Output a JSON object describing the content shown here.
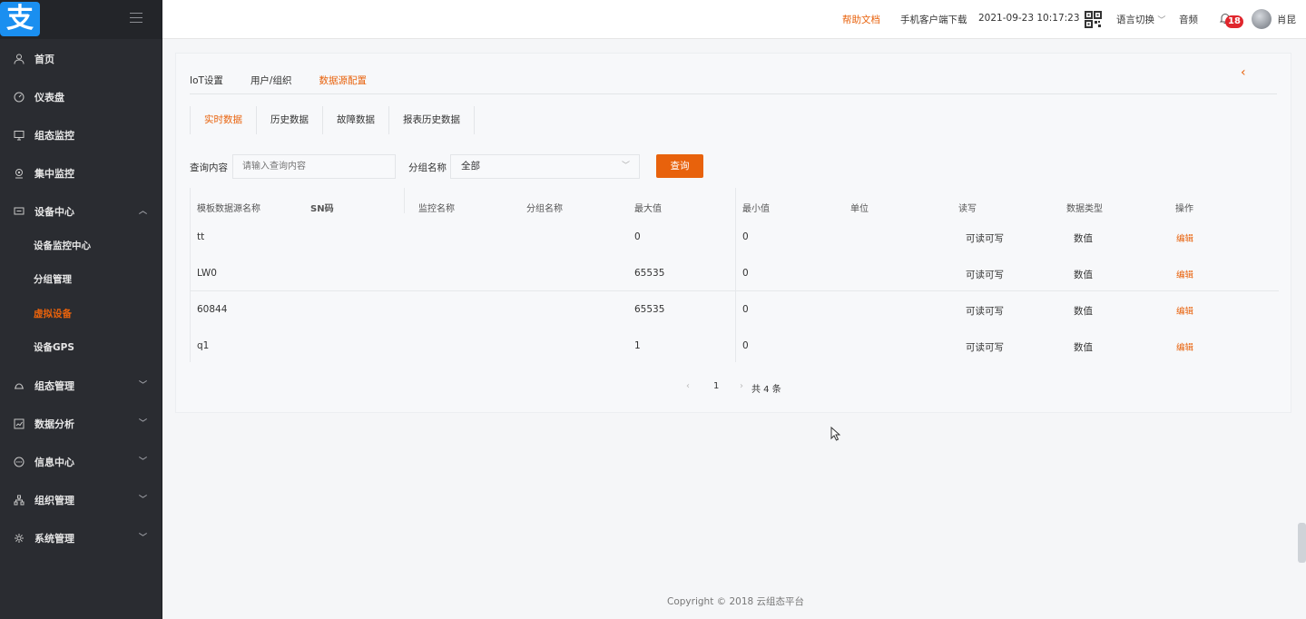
{
  "logo": {
    "glyph": "支"
  },
  "sidebar": {
    "items": [
      {
        "label": "首页",
        "icon": "user-icon"
      },
      {
        "label": "仪表盘",
        "icon": "dashboard-icon"
      },
      {
        "label": "组态监控",
        "icon": "monitor-icon"
      },
      {
        "label": "集中监控",
        "icon": "location-icon"
      },
      {
        "label": "设备中心",
        "icon": "device-icon",
        "expanded": true
      },
      {
        "label": "组态管理",
        "icon": "config-icon"
      },
      {
        "label": "数据分析",
        "icon": "chart-icon"
      },
      {
        "label": "信息中心",
        "icon": "message-icon"
      },
      {
        "label": "组织管理",
        "icon": "org-icon"
      },
      {
        "label": "系统管理",
        "icon": "settings-icon"
      }
    ],
    "sub_items": [
      {
        "label": "设备监控中心"
      },
      {
        "label": "分组管理"
      },
      {
        "label": "虚拟设备",
        "active": true
      },
      {
        "label": "设备GPS"
      }
    ]
  },
  "header": {
    "help": "帮助文档",
    "download": "手机客户端下载",
    "datetime": "2021-09-23 10:17:23",
    "language": "语言切换",
    "audio": "音频",
    "badge_count": "18",
    "username": "肖昆"
  },
  "tabs": [
    "IoT设置",
    "用户/组织",
    "数据源配置"
  ],
  "sub_tabs": [
    "实时数据",
    "历史数据",
    "故障数据",
    "报表历史数据"
  ],
  "search": {
    "query_label": "查询内容",
    "query_placeholder": "请输入查询内容",
    "group_label": "分组名称",
    "group_value": "全部",
    "button": "查询"
  },
  "table": {
    "headers": [
      "模板数据源名称",
      "SN码",
      "监控名称",
      "分组名称",
      "最大值",
      "最小值",
      "单位",
      "读写",
      "数据类型",
      "操作"
    ],
    "rows": [
      {
        "name": "tt",
        "max": "0",
        "min": "0",
        "rw": "可读可写",
        "type": "数值",
        "action": "编辑"
      },
      {
        "name": "LW0",
        "max": "65535",
        "min": "0",
        "rw": "可读可写",
        "type": "数值",
        "action": "编辑"
      },
      {
        "name": "60844",
        "max": "65535",
        "min": "0",
        "rw": "可读可写",
        "type": "数值",
        "action": "编辑"
      },
      {
        "name": "q1",
        "max": "1",
        "min": "0",
        "rw": "可读可写",
        "type": "数值",
        "action": "编辑"
      }
    ]
  },
  "pager": {
    "current": "1",
    "total": "共 4 条"
  },
  "footer": "Copyright © 2018 云组态平台",
  "colors": {
    "accent": "#e8620c",
    "sidebar": "#2a2c31",
    "badge": "#e0262d"
  }
}
